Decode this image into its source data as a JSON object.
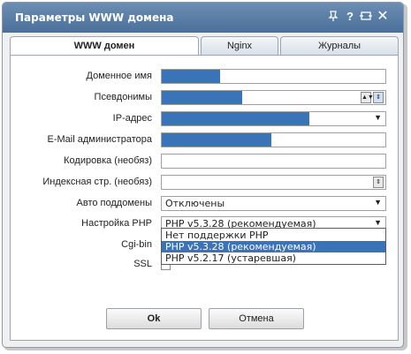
{
  "dialog": {
    "title": "Параметры WWW домена",
    "title_icons": [
      "pin-icon",
      "help-icon",
      "collapse-icon",
      "close-icon"
    ]
  },
  "tabs": [
    {
      "label": "WWW домен",
      "active": true
    },
    {
      "label": "Nginx",
      "active": false
    },
    {
      "label": "Журналы",
      "active": false
    }
  ],
  "form": {
    "domain_name_label": "Доменное имя",
    "aliases_label": "Псевдонимы",
    "ip_label": "IP-адрес",
    "admin_email_label": "E-Mail администратора",
    "encoding_label": "Кодировка (необяз)",
    "index_page_label": "Индексная стр. (необяз)",
    "auto_subdomains_label": "Авто поддомены",
    "auto_subdomains_value": "Отключены",
    "php_label": "Настройка PHP",
    "php_value": "PHP v5.3.28 (рекомендуемая)",
    "php_options": [
      {
        "label": "Нет поддержки PHP",
        "highlighted": false
      },
      {
        "label": "PHP v5.3.28 (рекомендуемая)",
        "highlighted": true
      },
      {
        "label": "PHP v5.2.17 (устаревшая)",
        "highlighted": false
      }
    ],
    "cgi_label": "Cgi-bin",
    "ssl_label": "SSL"
  },
  "buttons": {
    "ok": "Ok",
    "cancel": "Отмена"
  },
  "colors": {
    "titlebar": "#5a7fa8",
    "selection": "#3a73b8"
  }
}
